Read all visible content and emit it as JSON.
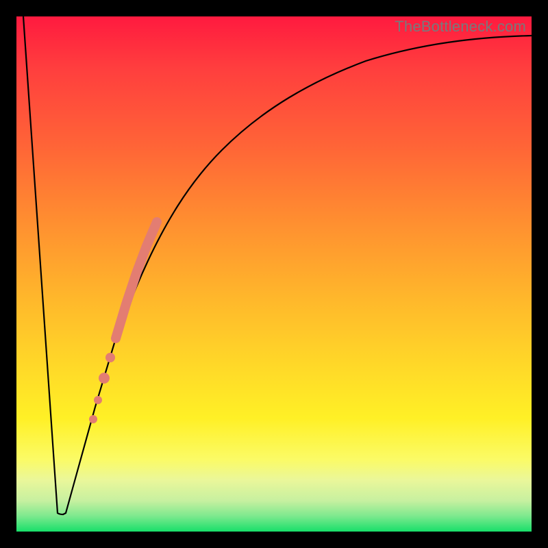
{
  "watermark": {
    "text": "TheBottleneck.com"
  },
  "colors": {
    "gradient_top": "#ff1a3f",
    "gradient_mid1": "#ff8f30",
    "gradient_mid2": "#fff026",
    "gradient_bottom": "#18df6a",
    "curve": "#000000",
    "marker": "#e37d72",
    "frame": "#000000"
  },
  "chart_data": {
    "type": "line",
    "title": "",
    "xlabel": "",
    "ylabel": "",
    "xlim": [
      0,
      100
    ],
    "ylim": [
      0,
      100
    ],
    "grid": false,
    "legend": false,
    "note": "Axes are unlabeled in the image; x and y are normalized 0–100. y maps 0→bottom(green) to 100→top(red). Values below are read from the rendered curve path.",
    "x": [
      0,
      2.8,
      5.0,
      7.5,
      8.2,
      9.0,
      10.5,
      12.0,
      14.0,
      16.0,
      18.0,
      20.0,
      22.0,
      24.0,
      26.5,
      28.0,
      30.0,
      33.0,
      36.0,
      40.0,
      45.0,
      50.0,
      55.0,
      60.0,
      65.0,
      70.0,
      75.0,
      80.0,
      85.0,
      90.0,
      95.0,
      100.0
    ],
    "values": [
      100.0,
      50.0,
      20.0,
      3.6,
      3.6,
      3.6,
      8.0,
      15.0,
      24.0,
      33.0,
      40.5,
      47.0,
      53.0,
      58.0,
      63.0,
      66.3,
      70.0,
      74.0,
      77.5,
      81.0,
      84.5,
      87.0,
      89.0,
      90.5,
      91.8,
      92.8,
      93.6,
      94.3,
      94.9,
      95.4,
      95.8,
      96.1
    ],
    "markers": {
      "note": "thick salmon segment and dots along the rising branch",
      "segment": {
        "x_start": 19.0,
        "x_end": 27.0
      },
      "dots": [
        {
          "x": 17.7,
          "y": 39.0
        },
        {
          "x": 16.3,
          "y": 34.0
        },
        {
          "x": 15.3,
          "y": 29.5
        },
        {
          "x": 14.6,
          "y": 26.0
        }
      ]
    }
  }
}
